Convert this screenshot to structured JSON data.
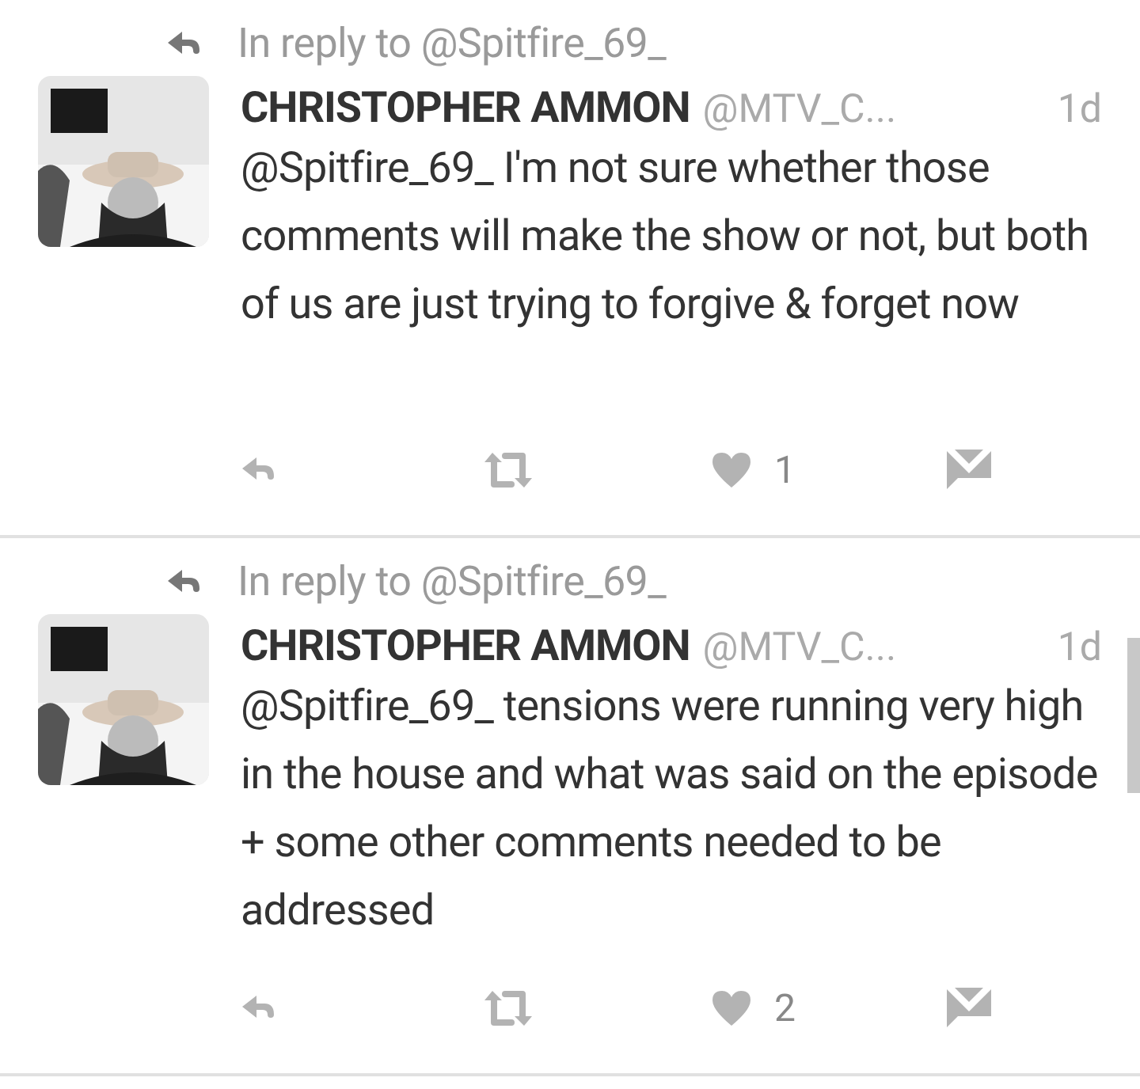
{
  "tweets": [
    {
      "reply_to": "In reply to @Spitfire_69_",
      "name": "CHRISTOPHER AMMON",
      "handle": "@MTV_C...",
      "time": "1d",
      "text": "@Spitfire_69_ I'm not sure whether those comments will make the show or not, but both of us are just trying to forgive & forget now",
      "like_count": "1"
    },
    {
      "reply_to": "In reply to @Spitfire_69_",
      "name": "CHRISTOPHER AMMON",
      "handle": "@MTV_C...",
      "time": "1d",
      "text": "@Spitfire_69_ tensions were running very high in the house and what was said on the episode + some other comments needed to be addressed",
      "like_count": "2"
    }
  ]
}
